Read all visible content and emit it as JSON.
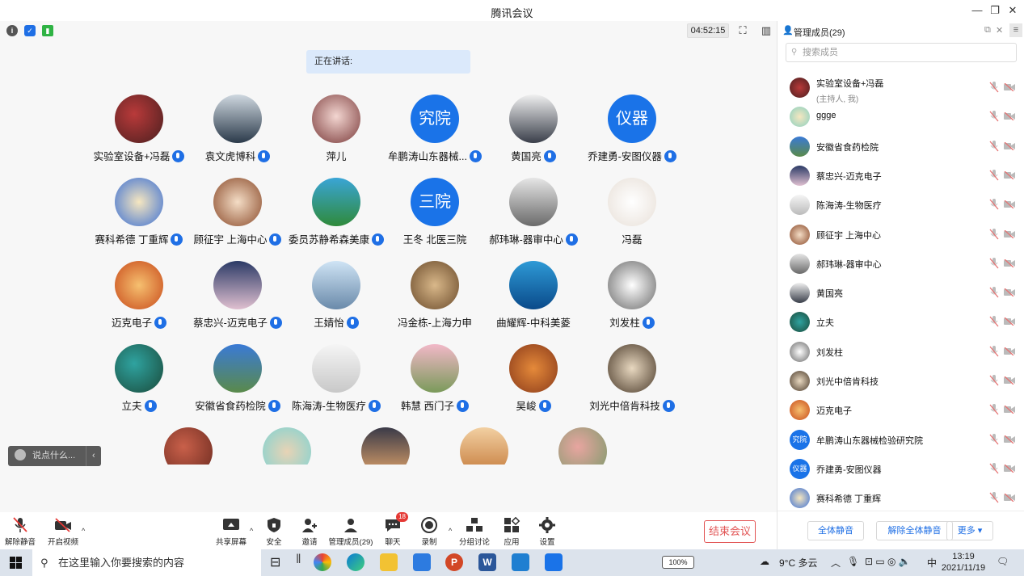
{
  "window": {
    "title": "腾讯会议"
  },
  "topbar": {
    "timer": "04:52:15"
  },
  "speaking_label": "正在讲话:",
  "participants": [
    {
      "name": "实验室设备+冯磊",
      "mic": true
    },
    {
      "name": "袁文虎博科",
      "mic": true
    },
    {
      "name": "萍儿",
      "mic": false
    },
    {
      "name": "牟鹏涛山东器械...",
      "mic": true,
      "avatar_text": "究院"
    },
    {
      "name": "黄国亮",
      "mic": true
    },
    {
      "name": "乔建勇-安图仪器",
      "mic": true,
      "avatar_text": "仪器"
    },
    {
      "name": "赛科希德 丁重辉",
      "mic": true
    },
    {
      "name": "顾征宇 上海中心",
      "mic": true
    },
    {
      "name": "委员苏静希森美康",
      "mic": true
    },
    {
      "name": "王冬 北医三院",
      "mic": false,
      "avatar_text": "三院"
    },
    {
      "name": "郝玮琳-器审中心",
      "mic": true
    },
    {
      "name": "冯磊",
      "mic": false
    },
    {
      "name": "迈克电子",
      "mic": true
    },
    {
      "name": "蔡忠兴-迈克电子",
      "mic": true
    },
    {
      "name": "王婧怡",
      "mic": true
    },
    {
      "name": "冯金栋-上海力申",
      "mic": false
    },
    {
      "name": "曲耀辉-中科美菱",
      "mic": false
    },
    {
      "name": "刘发柱",
      "mic": true
    },
    {
      "name": "立夫",
      "mic": true
    },
    {
      "name": "安徽省食药检院",
      "mic": true
    },
    {
      "name": "陈海涛-生物医疗",
      "mic": true
    },
    {
      "name": "韩慧 西门子",
      "mic": true
    },
    {
      "name": "吴峻",
      "mic": true
    },
    {
      "name": "刘光中倍肯科技",
      "mic": true
    }
  ],
  "chat_placeholder": "说点什么...",
  "toolbar": {
    "unmute": "解除静音",
    "video": "开启视频",
    "share": "共享屏幕",
    "security": "安全",
    "invite": "邀请",
    "members": "管理成员(29)",
    "chat": "聊天",
    "chat_badge": "18",
    "record": "录制",
    "breakout": "分组讨论",
    "apps": "应用",
    "settings": "设置",
    "end": "结束会议"
  },
  "side": {
    "title": "管理成员(29)",
    "search_placeholder": "搜索成员",
    "members": [
      {
        "name": "实验室设备+冯磊",
        "sub": "(主持人, 我)"
      },
      {
        "name": "ggge"
      },
      {
        "name": "安徽省食药检院"
      },
      {
        "name": "蔡忠兴-迈克电子"
      },
      {
        "name": "陈海涛-生物医疗"
      },
      {
        "name": "顾征宇 上海中心"
      },
      {
        "name": "郝玮琳-器审中心"
      },
      {
        "name": "黄国亮"
      },
      {
        "name": "立夫"
      },
      {
        "name": "刘发柱"
      },
      {
        "name": "刘光中倍肯科技"
      },
      {
        "name": "迈克电子"
      },
      {
        "name": "牟鹏涛山东器械检验研究院",
        "avatar_text": "究院"
      },
      {
        "name": "乔建勇-安图仪器",
        "avatar_text": "仪器"
      },
      {
        "name": "赛科希德 丁重辉"
      }
    ],
    "footer": {
      "mute_all": "全体静音",
      "unmute_all": "解除全体静音",
      "more": "更多 ▾"
    }
  },
  "taskbar": {
    "search_placeholder": "在这里输入你要搜索的内容",
    "battery": "100%",
    "weather": "9°C 多云",
    "ime": "中",
    "time": "13:19",
    "date": "2021/11/19"
  }
}
